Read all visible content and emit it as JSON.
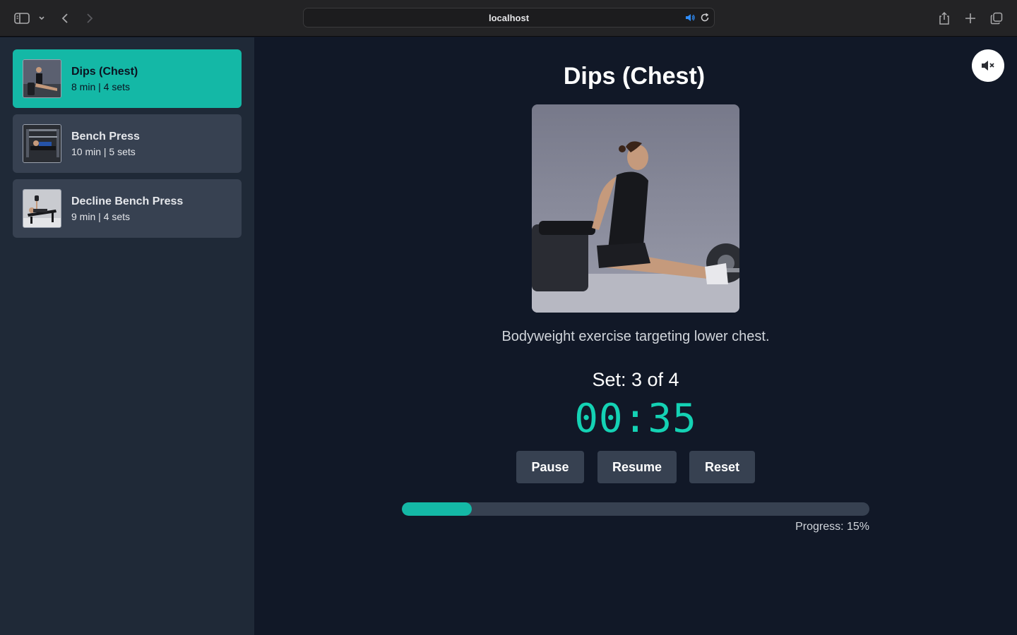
{
  "browser": {
    "url": "localhost",
    "icons": [
      "sidebar-toggle-icon",
      "chevron-down-icon",
      "back-icon",
      "forward-icon",
      "speaker-icon",
      "reload-icon",
      "share-icon",
      "new-tab-icon",
      "tabs-overview-icon"
    ]
  },
  "sidebar": {
    "items": [
      {
        "title": "Dips (Chest)",
        "meta": "8 min | 4 sets",
        "active": true
      },
      {
        "title": "Bench Press",
        "meta": "10 min | 5 sets",
        "active": false
      },
      {
        "title": "Decline Bench Press",
        "meta": "9 min | 4 sets",
        "active": false
      }
    ]
  },
  "main": {
    "title": "Dips (Chest)",
    "description": "Bodyweight exercise targeting lower chest.",
    "set_line": "Set: 3 of 4",
    "timer": "00:35",
    "buttons": {
      "pause": "Pause",
      "resume": "Resume",
      "reset": "Reset"
    },
    "progress_percent": 15,
    "progress_label": "Progress: 15%"
  },
  "colors": {
    "accent": "#14b8a6",
    "timer": "#14d2b4",
    "sidebar_bg": "#1f2937",
    "main_bg": "#111827",
    "card_bg": "#374151"
  }
}
